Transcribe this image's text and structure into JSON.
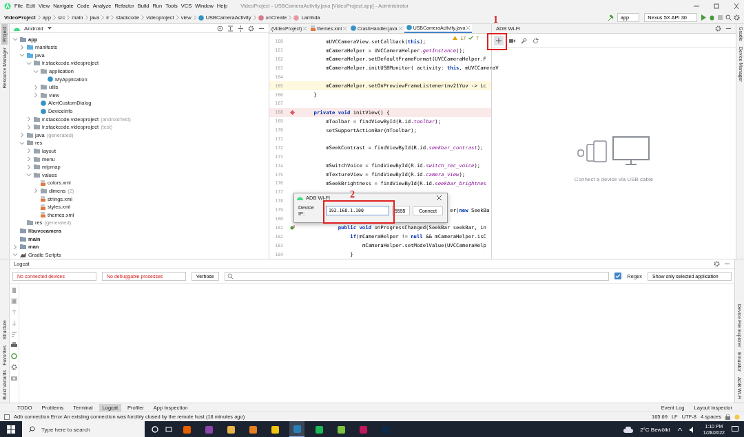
{
  "menu": [
    "File",
    "Edit",
    "View",
    "Navigate",
    "Code",
    "Analyze",
    "Refactor",
    "Build",
    "Run",
    "Tools",
    "VCS",
    "Window",
    "Help"
  ],
  "window": {
    "title": "VideoProject - USBCameraActivity.java [VideoProject.app] - Administrator"
  },
  "breadcrumbs": [
    {
      "label": "VideoProject",
      "kind": "project"
    },
    {
      "label": "app",
      "kind": "folder"
    },
    {
      "label": "src",
      "kind": "folder"
    },
    {
      "label": "main",
      "kind": "folder"
    },
    {
      "label": "java",
      "kind": "folder"
    },
    {
      "label": "ir",
      "kind": "folder"
    },
    {
      "label": "stackcode",
      "kind": "folder"
    },
    {
      "label": "videoproject",
      "kind": "folder"
    },
    {
      "label": "view",
      "kind": "folder"
    },
    {
      "label": "USBCameraActivity",
      "kind": "class"
    },
    {
      "label": "onCreate",
      "kind": "method"
    },
    {
      "label": "Lambda",
      "kind": "lambda"
    }
  ],
  "run_config": {
    "module": "app",
    "device": "Nexus 5X API 30"
  },
  "left_strip": {
    "top": [
      {
        "label": "Project",
        "selected": true
      },
      {
        "label": "Resource Manager",
        "selected": false
      }
    ],
    "bottom": [
      {
        "label": "Structure"
      },
      {
        "label": "Favorites"
      },
      {
        "label": "Build Variants"
      }
    ]
  },
  "right_strip": {
    "top": [
      {
        "label": "Gradle"
      },
      {
        "label": "Device Manager"
      }
    ],
    "bottom": [
      {
        "label": "Device File Explorer"
      },
      {
        "label": "Emulator"
      },
      {
        "label": "ADB Wi-Fi"
      }
    ]
  },
  "project": {
    "view": "Android",
    "tree": [
      {
        "label": "app",
        "kind": "module",
        "expanded": true,
        "children": [
          {
            "label": "manifests",
            "kind": "folder",
            "expanded": false
          },
          {
            "label": "java",
            "kind": "folder",
            "expanded": true,
            "children": [
              {
                "label": "ir.stackcode.videoproject",
                "kind": "package",
                "expanded": true,
                "children": [
                  {
                    "label": "application",
                    "kind": "package",
                    "expanded": true,
                    "children": [
                      {
                        "label": "MyApplication",
                        "kind": "class"
                      }
                    ]
                  },
                  {
                    "label": "utils",
                    "kind": "package",
                    "expanded": false
                  },
                  {
                    "label": "view",
                    "kind": "package",
                    "expanded": false
                  },
                  {
                    "label": "AlertCustomDialog",
                    "kind": "class"
                  },
                  {
                    "label": "DeviceInfo",
                    "kind": "class"
                  }
                ]
              },
              {
                "label": "ir.stackcode.videoproject",
                "note": "(androidTest)",
                "kind": "package",
                "expanded": false
              },
              {
                "label": "ir.stackcode.videoproject",
                "note": "(test)",
                "kind": "package",
                "expanded": false
              }
            ]
          },
          {
            "label": "java",
            "note": "(generated)",
            "kind": "generated",
            "expanded": false
          },
          {
            "label": "res",
            "kind": "res",
            "expanded": true,
            "children": [
              {
                "label": "layout",
                "kind": "package",
                "expanded": false
              },
              {
                "label": "menu",
                "kind": "package",
                "expanded": false
              },
              {
                "label": "mipmap",
                "kind": "package",
                "expanded": false
              },
              {
                "label": "values",
                "kind": "package",
                "expanded": true,
                "children": [
                  {
                    "label": "colors.xml",
                    "kind": "xml"
                  },
                  {
                    "label": "dimens",
                    "note": "(2)",
                    "kind": "package",
                    "expanded": false
                  },
                  {
                    "label": "strings.xml",
                    "kind": "xml"
                  },
                  {
                    "label": "styles.xml",
                    "kind": "xml"
                  },
                  {
                    "label": "themes.xml",
                    "kind": "xml"
                  }
                ]
              }
            ]
          },
          {
            "label": "res",
            "note": "(generated)",
            "kind": "res"
          }
        ]
      },
      {
        "label": "libuvccamera",
        "kind": "module"
      },
      {
        "label": "main",
        "kind": "module"
      },
      {
        "label": "man",
        "kind": "module",
        "expanded": false
      },
      {
        "label": "Gradle Scripts",
        "kind": "gradle",
        "expanded": true
      }
    ]
  },
  "editor": {
    "tabs": [
      {
        "label": "(VideoProject)",
        "kind": "module",
        "selected": false
      },
      {
        "label": "themes.xml",
        "kind": "xml",
        "selected": false
      },
      {
        "label": "CrashHandler.java",
        "kind": "class",
        "selected": false
      },
      {
        "label": "USBCameraActivity.java",
        "kind": "class",
        "selected": true
      }
    ],
    "warnings": "17",
    "weak_warnings": "7",
    "lines": [
      {
        "n": "160",
        "kind": "plain",
        "code": "        mUVCCameraView.setCallback(**this**);"
      },
      {
        "n": "161",
        "kind": "plain",
        "code": "        mCameraHelper = UVCCameraHelper.*getInstance*();"
      },
      {
        "n": "162",
        "kind": "plain",
        "code": "        mCameraHelper.setDefaultFrameFormat(UVCCameraHelper.F"
      },
      {
        "n": "163",
        "kind": "plain",
        "code": "        mCameraHelper.initUSBMonitor( activity: **this**, mUVCCameraV"
      },
      {
        "n": "164",
        "kind": "plain"
      },
      {
        "n": "165",
        "kind": "current",
        "code": "        mCameraHelper.setOnPreviewFrameListener(nv21Yuv -> Lc"
      },
      {
        "n": "166",
        "kind": "plain",
        "code": "    }"
      },
      {
        "n": "167",
        "kind": "plain"
      },
      {
        "n": "168",
        "kind": "breakpoint",
        "code": "    **private void** initView() {"
      },
      {
        "n": "169",
        "kind": "plain",
        "code": "        mToolbar = findViewById(R.id.*toolbar*);"
      },
      {
        "n": "170",
        "kind": "plain",
        "code": "        setSupportActionBar(mToolbar);"
      },
      {
        "n": "171",
        "kind": "plain"
      },
      {
        "n": "172",
        "kind": "plain",
        "code": "        mSeekContrast = findViewById(R.id.*seekbar_contrast*);"
      },
      {
        "n": "173",
        "kind": "plain"
      },
      {
        "n": "174",
        "kind": "plain",
        "code": "        mSwitchVoice = findViewById(R.id.*switch_rec_voice*);"
      },
      {
        "n": "175",
        "kind": "plain",
        "code": "        mTextureView = findViewById(R.id.*camera_view*);"
      },
      {
        "n": "176",
        "kind": "plain",
        "code": "        mSeekBrightness = findViewById(R.id.*seekbar_brightnes*"
      },
      {
        "n": "177",
        "kind": "plain"
      },
      {
        "n": "178",
        "kind": "plain"
      },
      {
        "n": "179",
        "kind": "plain",
        "code": "                                                 er(**new** SeekBa"
      },
      {
        "n": "180",
        "kind": "plain"
      },
      {
        "n": "181",
        "kind": "override",
        "code": "            **public void** onProgressChanged(SeekBar seekBar, in"
      },
      {
        "n": "182",
        "kind": "plain",
        "code": "                **if**(mCameraHelper != **null** && mCameraHelper.isC"
      },
      {
        "n": "183",
        "kind": "plain",
        "code": "                    mCameraHelper.setModelValue(UVCCameraHelp"
      },
      {
        "n": "184",
        "kind": "plain",
        "code": "                }"
      }
    ]
  },
  "adb_panel": {
    "title": "ADB Wi-Fi",
    "empty_message": "Connect a device via USB cable"
  },
  "dialog": {
    "title": "ADB Wi-Fi",
    "ip_label": "Device IP:",
    "ip_value": "192.168.1.100",
    "port_value": "5555",
    "button": "Connect"
  },
  "annotations": [
    {
      "label": "1"
    },
    {
      "label": "2"
    }
  ],
  "logcat": {
    "title": "Logcat",
    "device": "No connected devices",
    "process": "No debuggable processes",
    "level": "Verbose",
    "regex": {
      "label": "Regex",
      "checked": true
    },
    "filter": "Show only selected application"
  },
  "tool_tabs": [
    {
      "label": "TODO",
      "selected": false
    },
    {
      "label": "Problems",
      "selected": false
    },
    {
      "label": "Terminal",
      "selected": false
    },
    {
      "label": "Logcat",
      "selected": true
    },
    {
      "label": "Profiler",
      "selected": false
    },
    {
      "label": "App Inspection",
      "selected": false
    }
  ],
  "tool_tabs_right": [
    "Event Log",
    "Layout Inspector"
  ],
  "status_bar": {
    "message": "Adb connection Error:An existing connection was forcibly closed by the remote host (18 minutes ago)",
    "position": "165:69",
    "line_sep": "LF",
    "encoding": "UTF-8",
    "indent": "4 spaces"
  },
  "taskbar": {
    "search_placeholder": "Type here to search",
    "apps": [
      {
        "color": "#e66000",
        "selected": false
      },
      {
        "color": "#8e44ad",
        "selected": false
      },
      {
        "color": "#e8b54a",
        "selected": false
      },
      {
        "color": "#e67e22",
        "selected": false
      },
      {
        "color": "#f1c40f",
        "selected": false
      },
      {
        "color": "#2980b9",
        "selected": true
      },
      {
        "color": "#1db954",
        "selected": false
      },
      {
        "color": "#7cc242",
        "selected": false
      },
      {
        "color": "#c2185b",
        "selected": false
      },
      {
        "color": "#0b2a4a",
        "selected": false
      }
    ],
    "weather": "2°C Bewölkt",
    "time": "1:10 PM",
    "date": "1/28/2022"
  }
}
